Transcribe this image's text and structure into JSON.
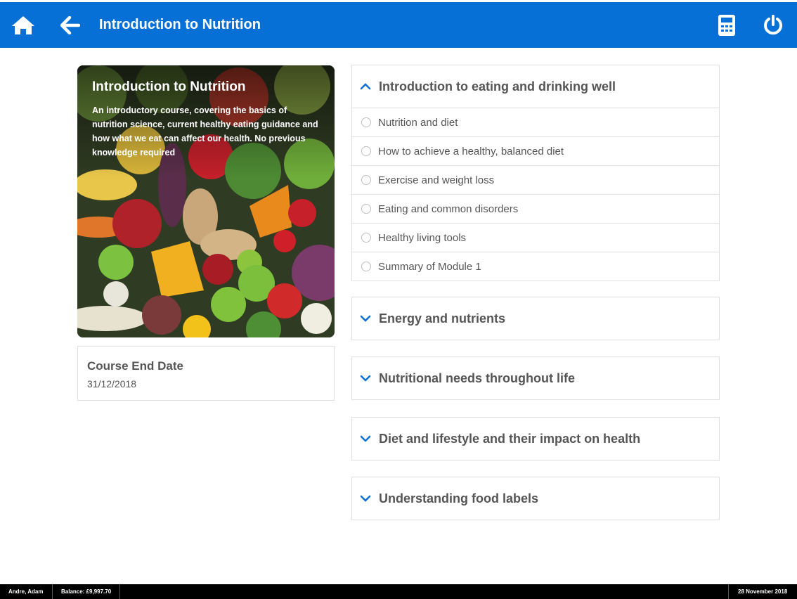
{
  "header": {
    "title": "Introduction to Nutrition",
    "icons": [
      "home-icon",
      "back-arrow-icon",
      "calculator-icon",
      "power-icon"
    ],
    "bar_color": "#0770d6"
  },
  "course": {
    "title": "Introduction to Nutrition",
    "description": "An introductory course, covering the basics of nutrition science, current healthy eating guidance and how what we eat can affect our health. No previous knowledge required",
    "end_date_label": "Course End Date",
    "end_date": "31/12/2018"
  },
  "modules": [
    {
      "title": "Introduction to eating and drinking well",
      "expanded": true,
      "items": [
        "Nutrition and diet",
        "How to achieve a healthy, balanced diet",
        "Exercise and weight loss",
        "Eating and common disorders",
        "Healthy living tools",
        "Summary of Module 1"
      ]
    },
    {
      "title": "Energy and nutrients",
      "expanded": false
    },
    {
      "title": "Nutritional needs throughout life",
      "expanded": false
    },
    {
      "title": "Diet and lifestyle and their impact on health",
      "expanded": false
    },
    {
      "title": "Understanding food labels",
      "expanded": false
    }
  ],
  "footer": {
    "user": "Andre, Adam",
    "balance": "Balance: £9,997.70",
    "date": "28 November 2018"
  }
}
